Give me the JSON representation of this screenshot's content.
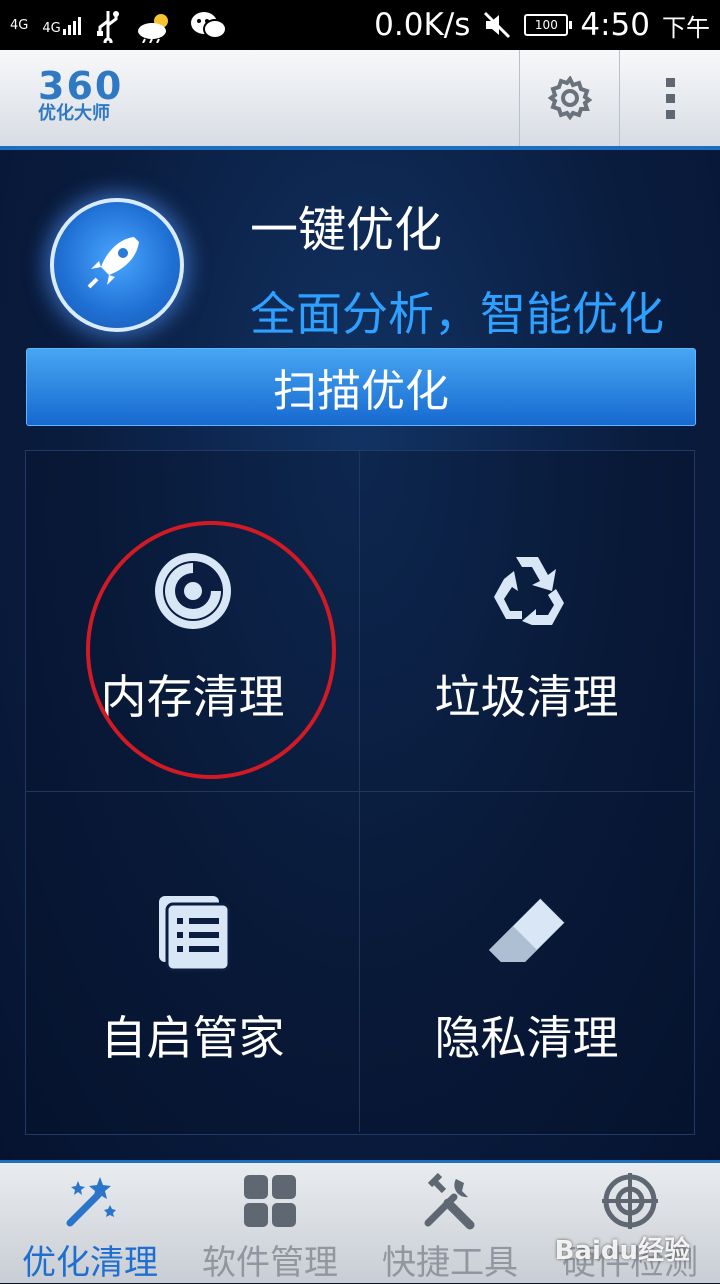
{
  "status": {
    "net1": "4G",
    "net2": "4G",
    "speed": "0.0K/s",
    "battery": "100",
    "time": "4:50",
    "ampm": "下午"
  },
  "app": {
    "logo_num": "360",
    "logo_text": "优化大师"
  },
  "header": {
    "title": "一键优化",
    "subtitle": "全面分析，智能优化",
    "scan_button": "扫描优化"
  },
  "tiles": [
    {
      "label": "内存清理",
      "icon": "memory-icon"
    },
    {
      "label": "垃圾清理",
      "icon": "recycle-icon"
    },
    {
      "label": "自启管家",
      "icon": "list-icon"
    },
    {
      "label": "隐私清理",
      "icon": "eraser-icon"
    }
  ],
  "bottom_nav": [
    {
      "label": "优化清理",
      "icon": "magic-wand-icon",
      "active": true
    },
    {
      "label": "软件管理",
      "icon": "grid-icon",
      "active": false
    },
    {
      "label": "快捷工具",
      "icon": "tools-icon",
      "active": false
    },
    {
      "label": "硬件检测",
      "icon": "target-icon",
      "active": false
    }
  ],
  "watermark": "Baidu经验",
  "colors": {
    "accent": "#1f6fd0",
    "highlight_circle": "#d11a24",
    "subtitle": "#2ea0ff"
  }
}
